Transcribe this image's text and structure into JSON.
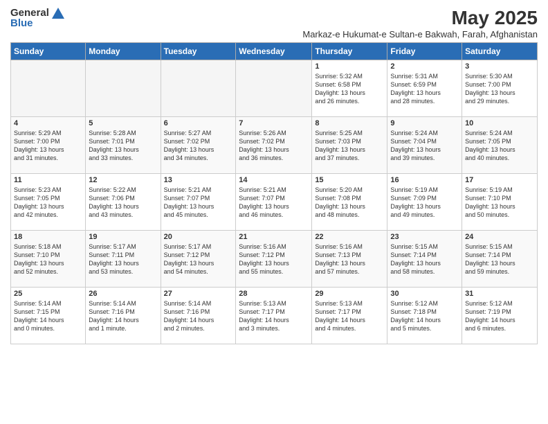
{
  "logo": {
    "general": "General",
    "blue": "Blue"
  },
  "title": "May 2025",
  "subtitle": "Markaz-e Hukumat-e Sultan-e Bakwah, Farah, Afghanistan",
  "weekdays": [
    "Sunday",
    "Monday",
    "Tuesday",
    "Wednesday",
    "Thursday",
    "Friday",
    "Saturday"
  ],
  "weeks": [
    [
      {
        "day": "",
        "info": ""
      },
      {
        "day": "",
        "info": ""
      },
      {
        "day": "",
        "info": ""
      },
      {
        "day": "",
        "info": ""
      },
      {
        "day": "1",
        "info": "Sunrise: 5:32 AM\nSunset: 6:58 PM\nDaylight: 13 hours\nand 26 minutes."
      },
      {
        "day": "2",
        "info": "Sunrise: 5:31 AM\nSunset: 6:59 PM\nDaylight: 13 hours\nand 28 minutes."
      },
      {
        "day": "3",
        "info": "Sunrise: 5:30 AM\nSunset: 7:00 PM\nDaylight: 13 hours\nand 29 minutes."
      }
    ],
    [
      {
        "day": "4",
        "info": "Sunrise: 5:29 AM\nSunset: 7:00 PM\nDaylight: 13 hours\nand 31 minutes."
      },
      {
        "day": "5",
        "info": "Sunrise: 5:28 AM\nSunset: 7:01 PM\nDaylight: 13 hours\nand 33 minutes."
      },
      {
        "day": "6",
        "info": "Sunrise: 5:27 AM\nSunset: 7:02 PM\nDaylight: 13 hours\nand 34 minutes."
      },
      {
        "day": "7",
        "info": "Sunrise: 5:26 AM\nSunset: 7:02 PM\nDaylight: 13 hours\nand 36 minutes."
      },
      {
        "day": "8",
        "info": "Sunrise: 5:25 AM\nSunset: 7:03 PM\nDaylight: 13 hours\nand 37 minutes."
      },
      {
        "day": "9",
        "info": "Sunrise: 5:24 AM\nSunset: 7:04 PM\nDaylight: 13 hours\nand 39 minutes."
      },
      {
        "day": "10",
        "info": "Sunrise: 5:24 AM\nSunset: 7:05 PM\nDaylight: 13 hours\nand 40 minutes."
      }
    ],
    [
      {
        "day": "11",
        "info": "Sunrise: 5:23 AM\nSunset: 7:05 PM\nDaylight: 13 hours\nand 42 minutes."
      },
      {
        "day": "12",
        "info": "Sunrise: 5:22 AM\nSunset: 7:06 PM\nDaylight: 13 hours\nand 43 minutes."
      },
      {
        "day": "13",
        "info": "Sunrise: 5:21 AM\nSunset: 7:07 PM\nDaylight: 13 hours\nand 45 minutes."
      },
      {
        "day": "14",
        "info": "Sunrise: 5:21 AM\nSunset: 7:07 PM\nDaylight: 13 hours\nand 46 minutes."
      },
      {
        "day": "15",
        "info": "Sunrise: 5:20 AM\nSunset: 7:08 PM\nDaylight: 13 hours\nand 48 minutes."
      },
      {
        "day": "16",
        "info": "Sunrise: 5:19 AM\nSunset: 7:09 PM\nDaylight: 13 hours\nand 49 minutes."
      },
      {
        "day": "17",
        "info": "Sunrise: 5:19 AM\nSunset: 7:10 PM\nDaylight: 13 hours\nand 50 minutes."
      }
    ],
    [
      {
        "day": "18",
        "info": "Sunrise: 5:18 AM\nSunset: 7:10 PM\nDaylight: 13 hours\nand 52 minutes."
      },
      {
        "day": "19",
        "info": "Sunrise: 5:17 AM\nSunset: 7:11 PM\nDaylight: 13 hours\nand 53 minutes."
      },
      {
        "day": "20",
        "info": "Sunrise: 5:17 AM\nSunset: 7:12 PM\nDaylight: 13 hours\nand 54 minutes."
      },
      {
        "day": "21",
        "info": "Sunrise: 5:16 AM\nSunset: 7:12 PM\nDaylight: 13 hours\nand 55 minutes."
      },
      {
        "day": "22",
        "info": "Sunrise: 5:16 AM\nSunset: 7:13 PM\nDaylight: 13 hours\nand 57 minutes."
      },
      {
        "day": "23",
        "info": "Sunrise: 5:15 AM\nSunset: 7:14 PM\nDaylight: 13 hours\nand 58 minutes."
      },
      {
        "day": "24",
        "info": "Sunrise: 5:15 AM\nSunset: 7:14 PM\nDaylight: 13 hours\nand 59 minutes."
      }
    ],
    [
      {
        "day": "25",
        "info": "Sunrise: 5:14 AM\nSunset: 7:15 PM\nDaylight: 14 hours\nand 0 minutes."
      },
      {
        "day": "26",
        "info": "Sunrise: 5:14 AM\nSunset: 7:16 PM\nDaylight: 14 hours\nand 1 minute."
      },
      {
        "day": "27",
        "info": "Sunrise: 5:14 AM\nSunset: 7:16 PM\nDaylight: 14 hours\nand 2 minutes."
      },
      {
        "day": "28",
        "info": "Sunrise: 5:13 AM\nSunset: 7:17 PM\nDaylight: 14 hours\nand 3 minutes."
      },
      {
        "day": "29",
        "info": "Sunrise: 5:13 AM\nSunset: 7:17 PM\nDaylight: 14 hours\nand 4 minutes."
      },
      {
        "day": "30",
        "info": "Sunrise: 5:12 AM\nSunset: 7:18 PM\nDaylight: 14 hours\nand 5 minutes."
      },
      {
        "day": "31",
        "info": "Sunrise: 5:12 AM\nSunset: 7:19 PM\nDaylight: 14 hours\nand 6 minutes."
      }
    ]
  ]
}
